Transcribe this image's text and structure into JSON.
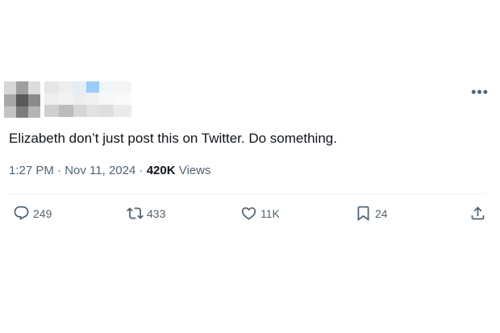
{
  "header": {
    "more_icon": "more-horizontal-icon"
  },
  "tweet": {
    "text": "Elizabeth don’t just post this on Twitter. Do something.",
    "time": "1:27 PM",
    "sep1": "·",
    "date": "Nov 11, 2024",
    "sep2": "·",
    "views_count": "420K",
    "views_label": "Views"
  },
  "actions": {
    "reply": {
      "icon": "reply-icon",
      "count": "249"
    },
    "retweet": {
      "icon": "retweet-icon",
      "count": "433"
    },
    "like": {
      "icon": "heart-icon",
      "count": "11K"
    },
    "bookmark": {
      "icon": "bookmark-icon",
      "count": "24"
    },
    "share": {
      "icon": "share-icon"
    }
  }
}
